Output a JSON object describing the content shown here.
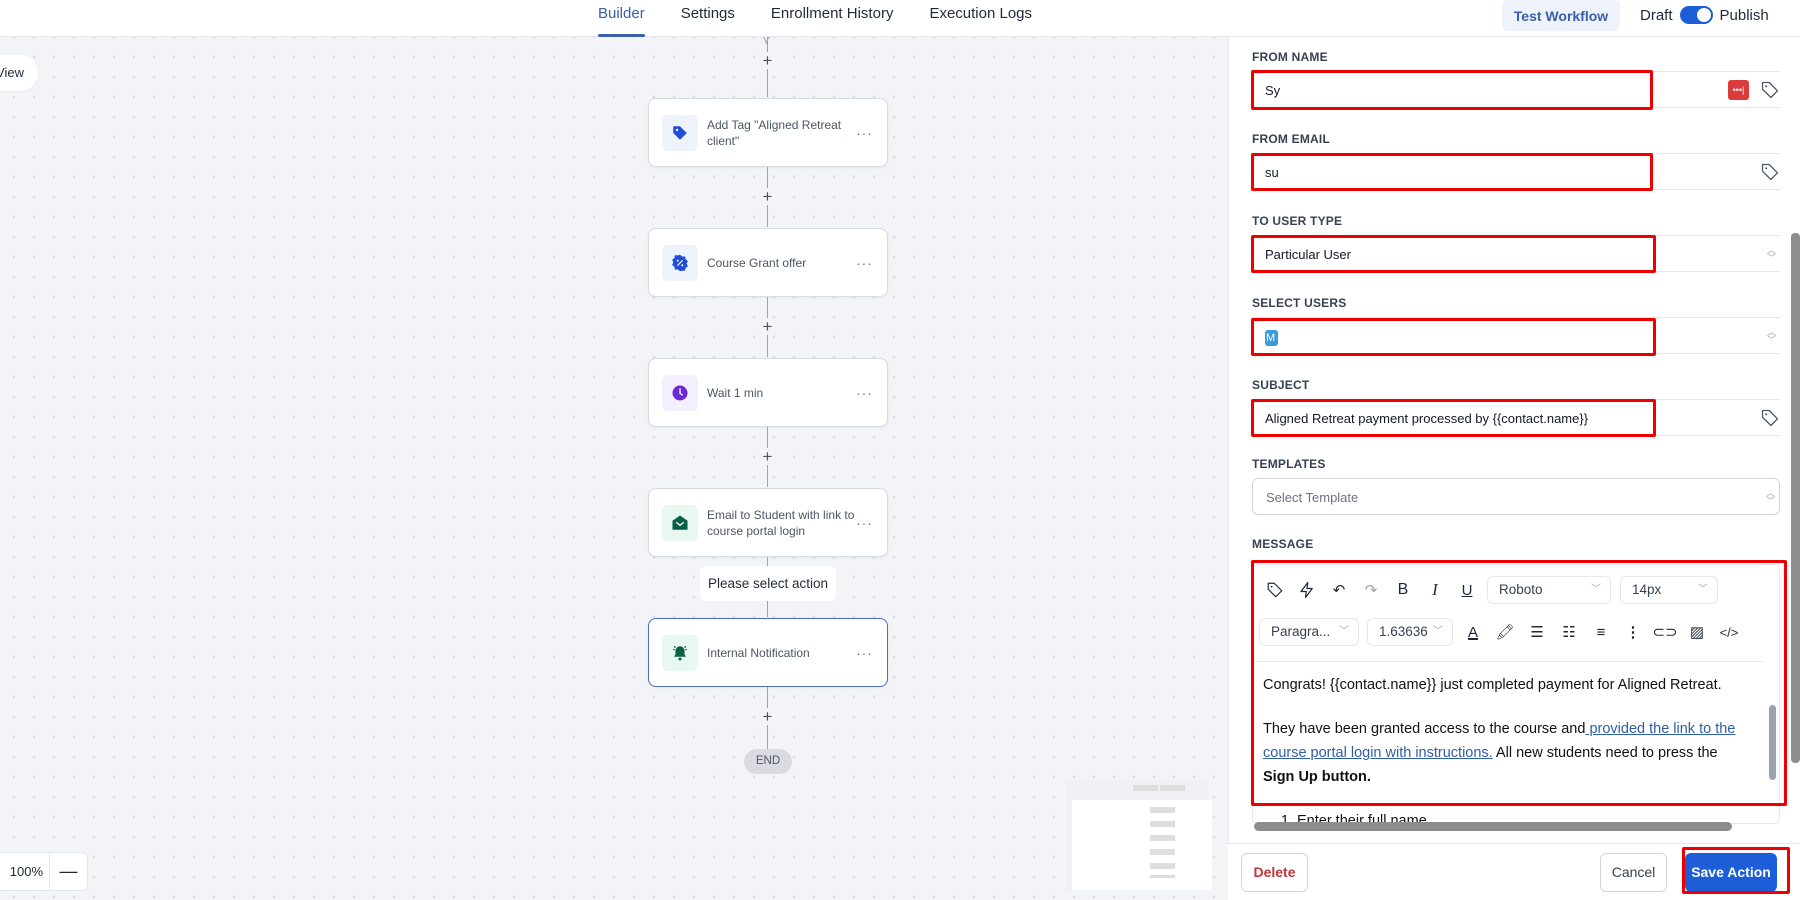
{
  "header": {
    "tabs": [
      {
        "label": "Builder",
        "active": true
      },
      {
        "label": "Settings",
        "active": false
      },
      {
        "label": "Enrollment History",
        "active": false
      },
      {
        "label": "Execution Logs",
        "active": false
      }
    ],
    "test_workflow_label": "Test Workflow",
    "draft_label": "Draft",
    "publish_label": "Publish",
    "publish_toggle_on": true
  },
  "canvas": {
    "view_label": "View",
    "zoom_level": "100%",
    "zoom_out_label": "—",
    "nodes": [
      {
        "label": "Add Tag \"Aligned Retreat client\"",
        "icon": "tag-icon",
        "icon_color": "#1d4ed8",
        "icon_bg": "#eef2fb"
      },
      {
        "label": "Course Grant offer",
        "icon": "badge-percent-icon",
        "icon_color": "#1d4ed8",
        "icon_bg": "#eef2fb"
      },
      {
        "label": "Wait 1 min",
        "icon": "clock-icon",
        "icon_color": "#6d28d9",
        "icon_bg": "#f3effc"
      },
      {
        "label": "Email to Student with link to course portal login",
        "icon": "envelope-open-icon",
        "icon_color": "#065f46",
        "icon_bg": "#e9f7f1"
      },
      {
        "label": "Internal Notification",
        "icon": "bell-ring-icon",
        "icon_color": "#065f46",
        "icon_bg": "#e9f7f1",
        "selected": true
      }
    ],
    "node_menu_label": "···",
    "select_action_tip": "Please select action",
    "end_label": "END"
  },
  "panel": {
    "from_name": {
      "label": "FROM NAME",
      "value": "Sy"
    },
    "from_email": {
      "label": "FROM EMAIL",
      "value": "su"
    },
    "to_user_type": {
      "label": "TO USER TYPE",
      "value": "Particular User"
    },
    "select_users": {
      "label": "SELECT USERS",
      "chip": "M"
    },
    "subject": {
      "label": "SUBJECT",
      "value": "Aligned Retreat payment processed by {{contact.name}}"
    },
    "templates": {
      "label": "TEMPLATES",
      "placeholder": "Select Template"
    },
    "message": {
      "label": "MESSAGE",
      "font_family": "Roboto",
      "font_size": "14px",
      "block_type": "Paragra...",
      "line_height": "1.63636",
      "body": {
        "p1": "Congrats! {{contact.name}} just completed payment for Aligned Retreat.",
        "p2_before": "They have been granted access to the course and",
        "p2_link": " provided the link to the course portal login with instructions.",
        "p2_after": " All new students need to press the ",
        "p2_bold": "Sign Up button.",
        "list_item_1": "Enter their full name"
      }
    },
    "password_badge": "•••|"
  },
  "footer": {
    "delete_label": "Delete",
    "cancel_label": "Cancel",
    "save_label": "Save Action"
  }
}
